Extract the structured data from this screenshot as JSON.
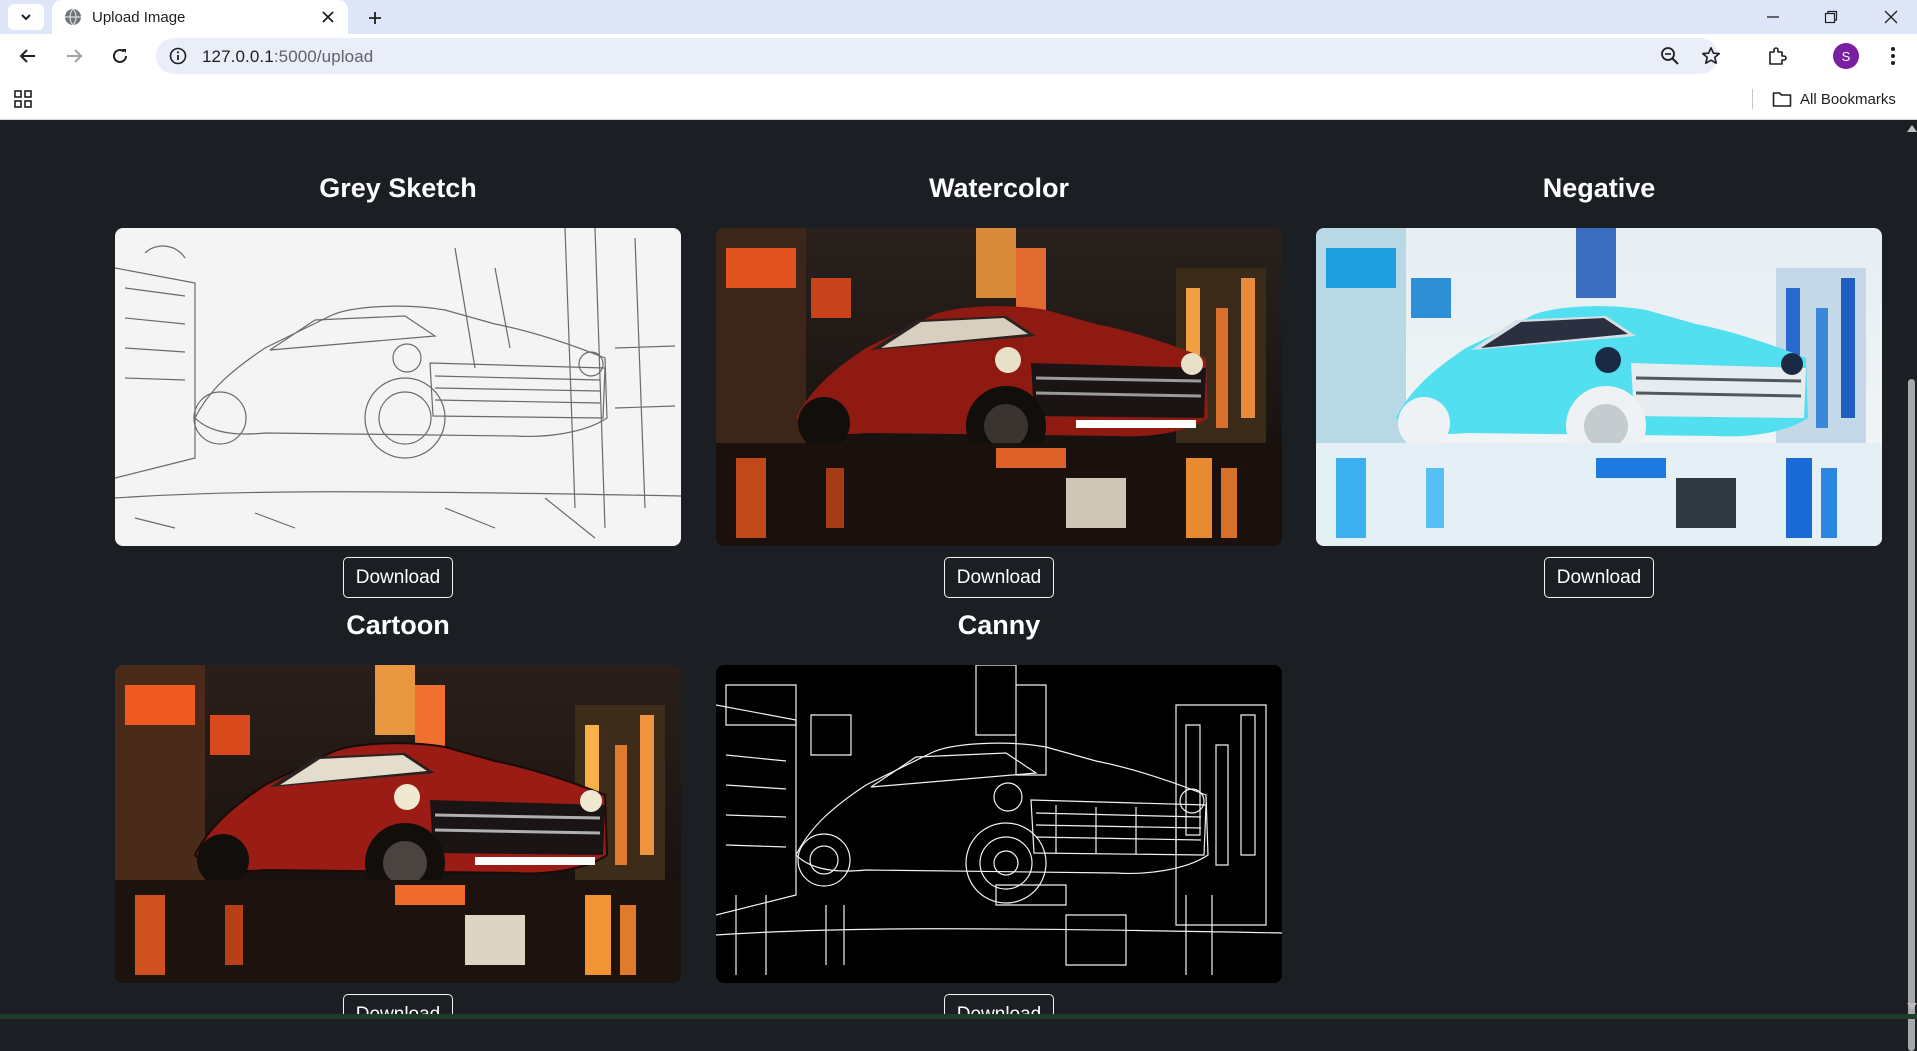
{
  "browser": {
    "tab_title": "Upload Image",
    "url_host": "127.0.0.1",
    "url_path": ":5000/upload",
    "profile_initial": "S",
    "bookmarks_label": "All Bookmarks"
  },
  "page": {
    "filters": [
      {
        "title": "Grey Sketch",
        "download_label": "Download"
      },
      {
        "title": "Watercolor",
        "download_label": "Download"
      },
      {
        "title": "Negative",
        "download_label": "Download"
      },
      {
        "title": "Cartoon",
        "download_label": "Download"
      },
      {
        "title": "Canny",
        "download_label": "Download"
      }
    ]
  },
  "colors": {
    "page_background": "#1b1f23",
    "profile_avatar": "#7b1fa2",
    "tabstrip": "#dfe6f7"
  }
}
